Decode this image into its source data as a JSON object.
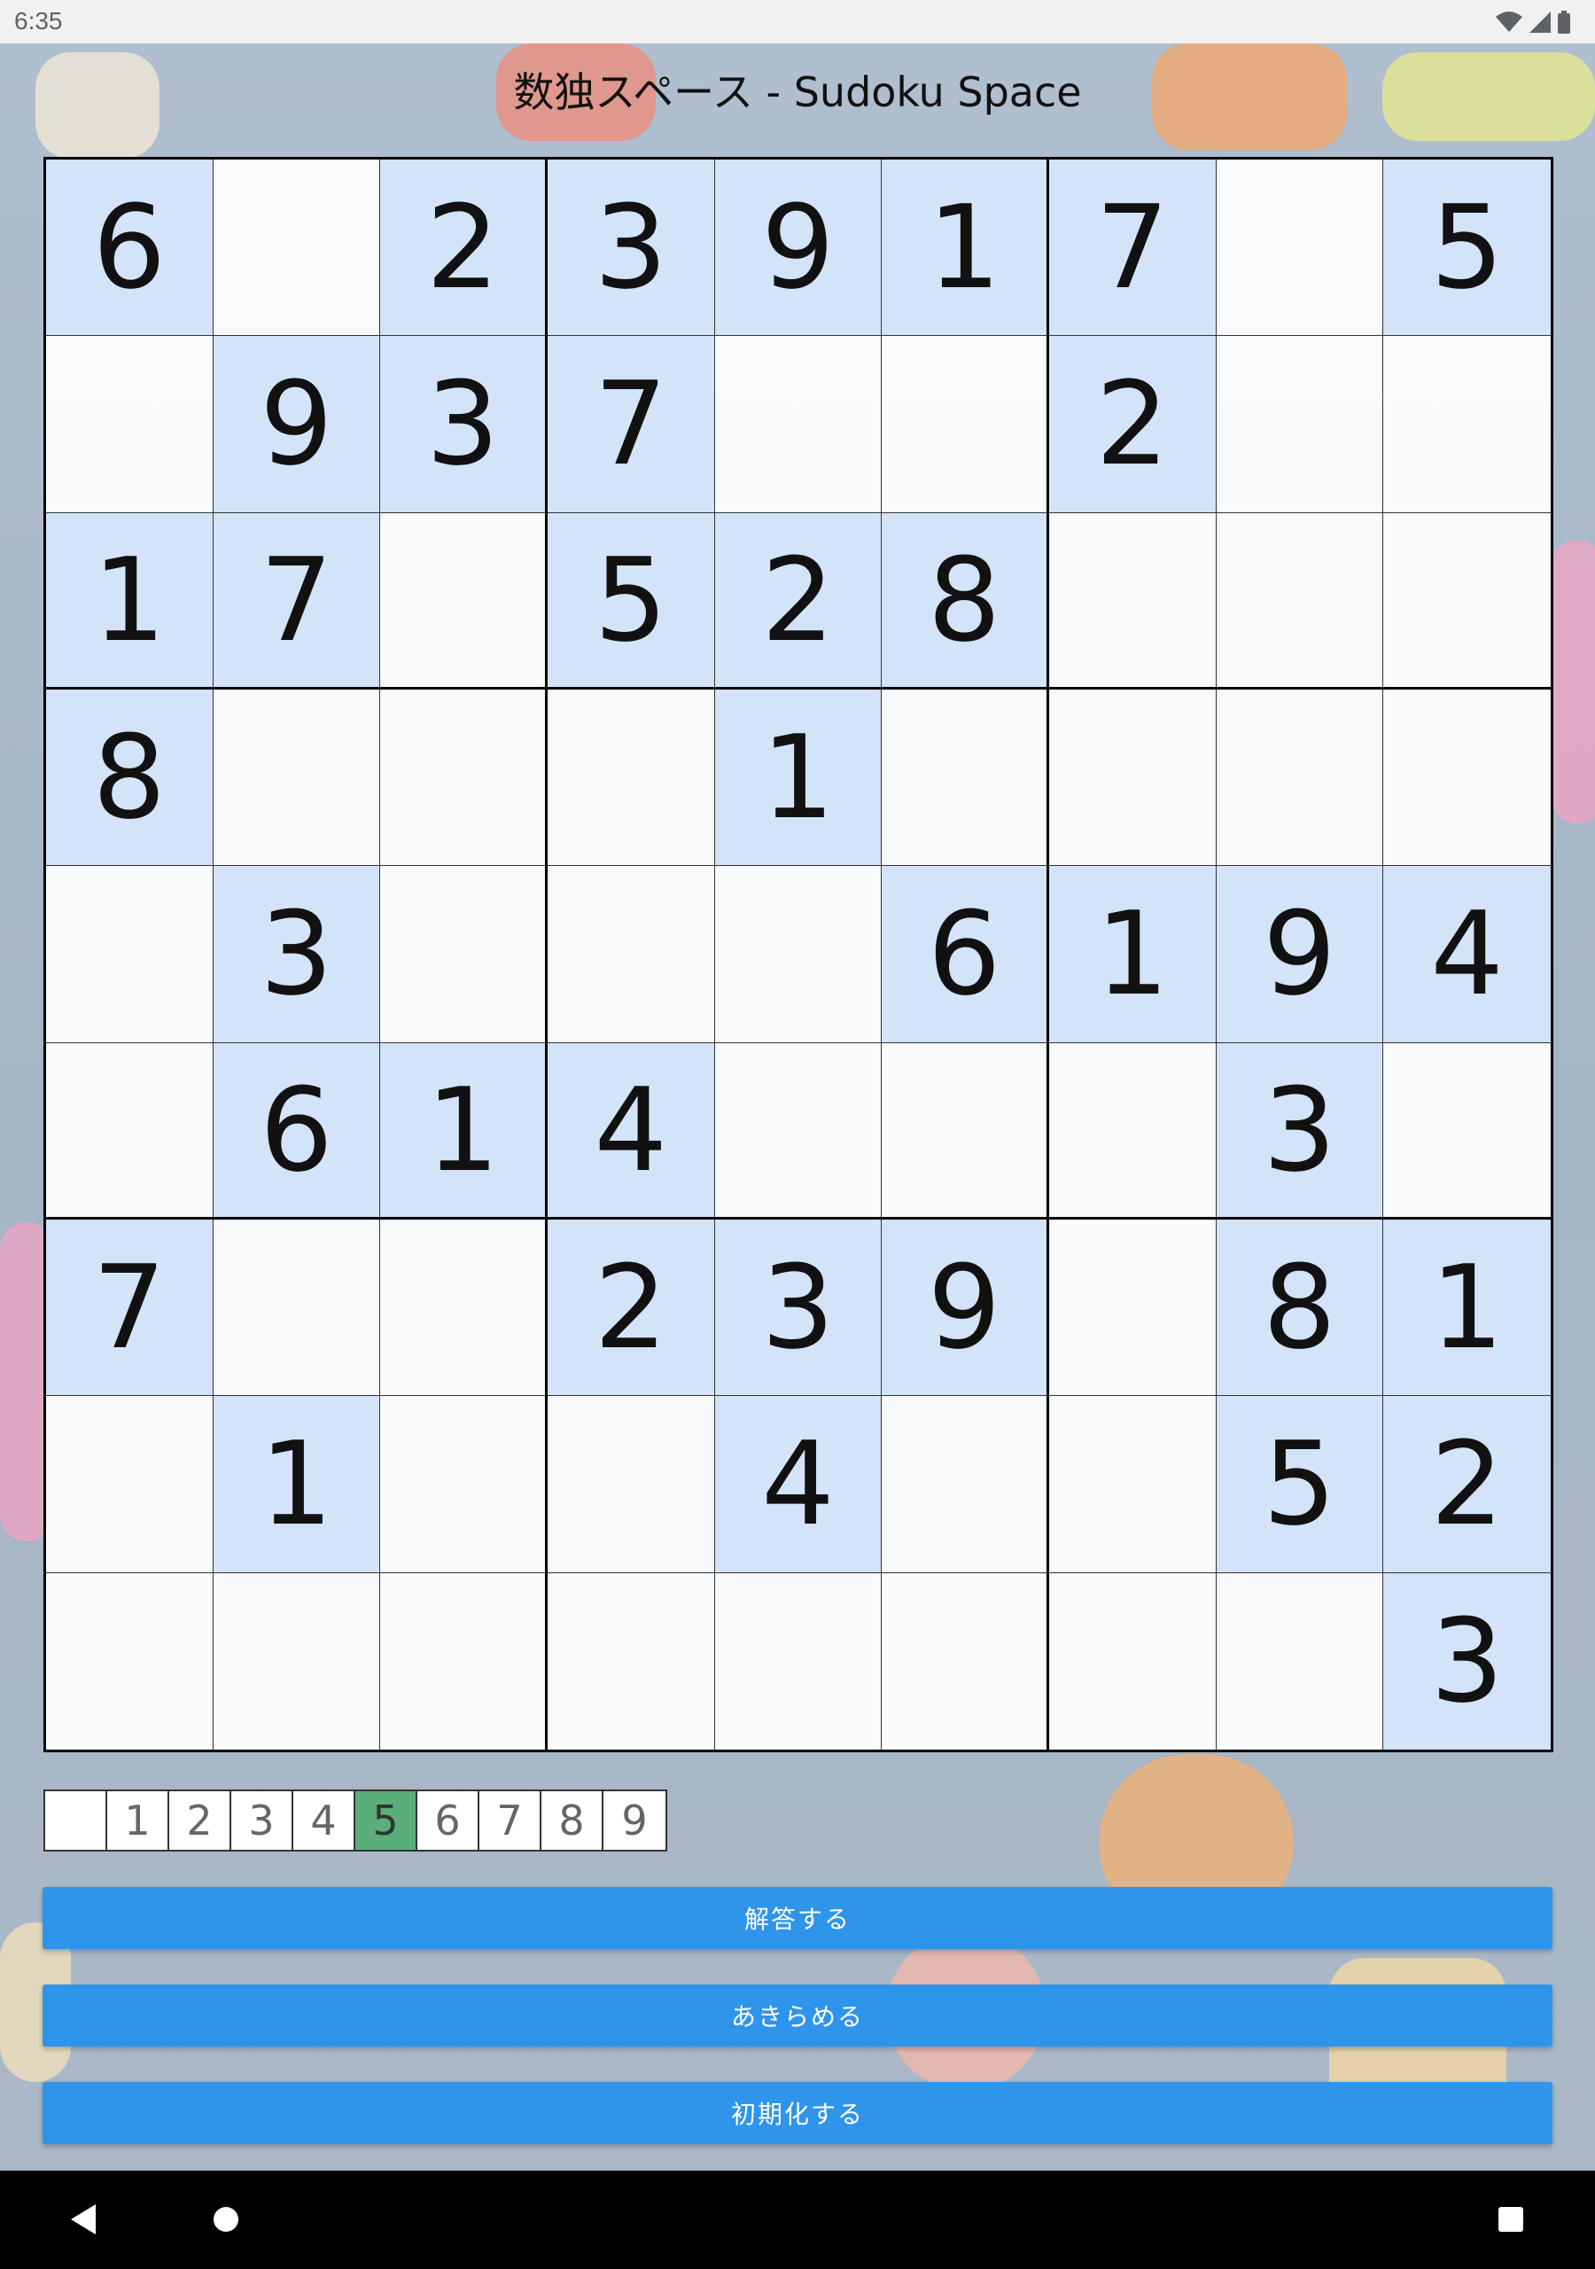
{
  "status_bar": {
    "time": "6:35",
    "icons": [
      "wifi-icon",
      "cellular-signal-icon",
      "battery-icon"
    ]
  },
  "app": {
    "title": "数独スペース - Sudoku Space"
  },
  "board": {
    "rows": [
      [
        "6",
        "",
        "2",
        "3",
        "9",
        "1",
        "7",
        "",
        "5"
      ],
      [
        "",
        "9",
        "3",
        "7",
        "",
        "",
        "2",
        "",
        ""
      ],
      [
        "1",
        "7",
        "",
        "5",
        "2",
        "8",
        "",
        "",
        ""
      ],
      [
        "8",
        "",
        "",
        "",
        "1",
        "",
        "",
        "",
        ""
      ],
      [
        "",
        "3",
        "",
        "",
        "",
        "6",
        "1",
        "9",
        "4"
      ],
      [
        "",
        "6",
        "1",
        "4",
        "",
        "",
        "",
        "3",
        ""
      ],
      [
        "7",
        "",
        "",
        "2",
        "3",
        "9",
        "",
        "8",
        "1"
      ],
      [
        "",
        "1",
        "",
        "",
        "4",
        "",
        "",
        "5",
        "2"
      ],
      [
        "",
        "",
        "",
        "",
        "",
        "",
        "",
        "",
        "3"
      ]
    ]
  },
  "palette": {
    "options": [
      "",
      "1",
      "2",
      "3",
      "4",
      "5",
      "6",
      "7",
      "8",
      "9"
    ],
    "selected": "5"
  },
  "actions": {
    "solve_label": "解答する",
    "give_up_label": "あきらめる",
    "reset_label": "初期化する"
  },
  "colors": {
    "given_cell": "#d2e4fa",
    "palette_selected": "#5aae7a",
    "action_button": "#2f95eb"
  },
  "nav_bar": {
    "icons": [
      "back-icon",
      "home-icon",
      "recent-apps-icon"
    ]
  }
}
